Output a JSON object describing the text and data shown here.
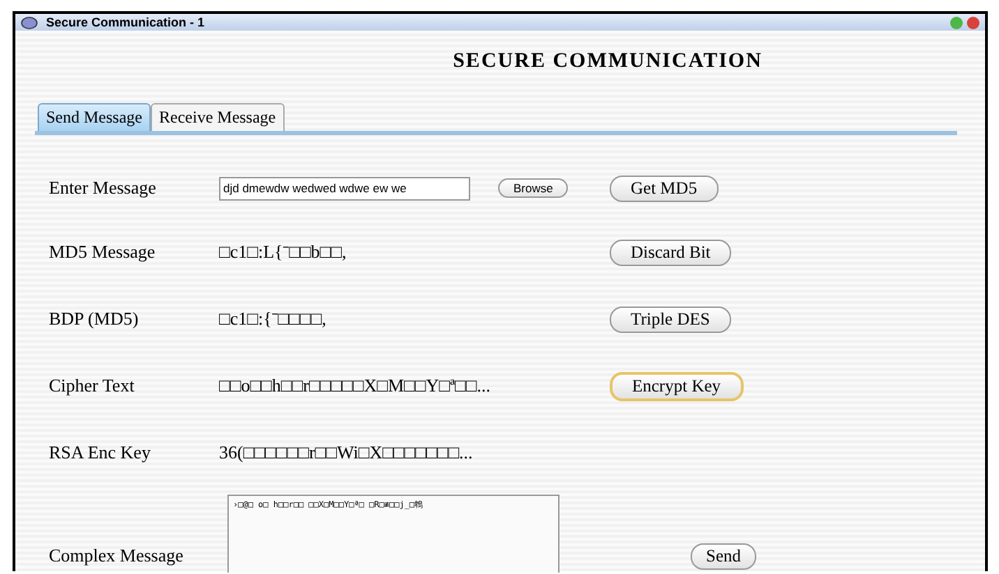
{
  "window": {
    "title": "Secure Communication - 1"
  },
  "heading": "SECURE COMMUNICATION",
  "tabs": [
    {
      "label": "Send Message",
      "selected": true
    },
    {
      "label": "Receive Message",
      "selected": false
    }
  ],
  "rows": [
    {
      "kind": "input",
      "label": "Enter Message",
      "value": "djd dmewdw wedwed wdwe ew we",
      "browse": "Browse",
      "button": {
        "label": "Get MD5",
        "focused": false
      }
    },
    {
      "kind": "value",
      "label": "MD5 Message",
      "value": "□c1□:L{ˉ□□b□□,",
      "button": {
        "label": "Discard Bit",
        "focused": false
      }
    },
    {
      "kind": "value",
      "label": "BDP (MD5)",
      "value": "□c1□:{ˉ□□□□,",
      "button": {
        "label": "Triple DES",
        "focused": false
      }
    },
    {
      "kind": "value",
      "label": "Cipher Text",
      "value": "□□o□□h□□r□□□□□X□M□□Y□ª□□...",
      "button": {
        "label": "Encrypt Key",
        "focused": true
      }
    },
    {
      "kind": "value",
      "label": "RSA Enc Key",
      "value": "36(□□□□□□r□□Wi□X□□□□□□□...",
      "button": null
    },
    {
      "kind": "textarea",
      "label": "Complex Message",
      "value": "›□@□ o□ h□□r□□ □□X□M□□Y□ª□ □R□≢□□j_□鵯",
      "button": {
        "label": "Send",
        "focused": false
      }
    }
  ]
}
